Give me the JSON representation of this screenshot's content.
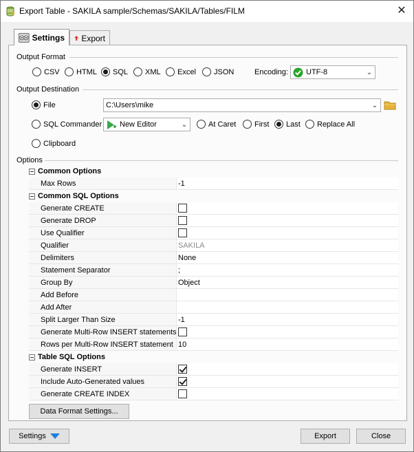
{
  "window": {
    "title": "Export Table - SAKILA sample/Schemas/SAKILA/Tables/FILM",
    "close_label": "✕"
  },
  "tabs": [
    {
      "label": "Settings"
    },
    {
      "label": "Export"
    }
  ],
  "output_format": {
    "label": "Output Format",
    "options": [
      "CSV",
      "HTML",
      "SQL",
      "XML",
      "Excel",
      "JSON"
    ],
    "selected": "SQL",
    "encoding_label": "Encoding:",
    "encoding_value": "UTF-8"
  },
  "output_destination": {
    "label": "Output Destination",
    "file_label": "File",
    "file_path": "C:\\Users\\mike",
    "sql_commander_label": "SQL Commander",
    "editor_value": "New Editor",
    "caret_options": [
      "At Caret",
      "First",
      "Last",
      "Replace All"
    ],
    "caret_selected": "Last",
    "clipboard_label": "Clipboard"
  },
  "options": {
    "label": "Options",
    "common_options": {
      "title": "Common Options",
      "max_rows_label": "Max Rows",
      "max_rows_value": "-1"
    },
    "common_sql_options": {
      "title": "Common SQL Options",
      "generate_create": "Generate CREATE",
      "generate_drop": "Generate DROP",
      "use_qualifier": "Use Qualifier",
      "qualifier_label": "Qualifier",
      "qualifier_value": "SAKILA",
      "delimiters_label": "Delimiters",
      "delimiters_value": "None",
      "separator_label": "Statement Separator",
      "separator_value": ";",
      "group_by_label": "Group By",
      "group_by_value": "Object",
      "add_before_label": "Add Before",
      "add_after_label": "Add After",
      "split_label": "Split Larger Than Size",
      "split_value": "-1",
      "multi_row_label": "Generate Multi-Row INSERT statements",
      "rows_per_label": "Rows per Multi-Row INSERT statement",
      "rows_per_value": "10"
    },
    "table_sql_options": {
      "title": "Table SQL Options",
      "generate_insert": "Generate INSERT",
      "include_auto": "Include Auto-Generated values",
      "create_index": "Generate CREATE INDEX"
    }
  },
  "buttons": {
    "data_format": "Data Format Settings...",
    "settings": "Settings",
    "export": "Export",
    "close": "Close"
  },
  "colors": {
    "accent_blue": "#1e7fd8",
    "encoding_check_green": "#2aa52a",
    "editor_green": "#3aa64a",
    "export_red": "#d23a2a",
    "folder_yellow": "#e8b23a"
  }
}
